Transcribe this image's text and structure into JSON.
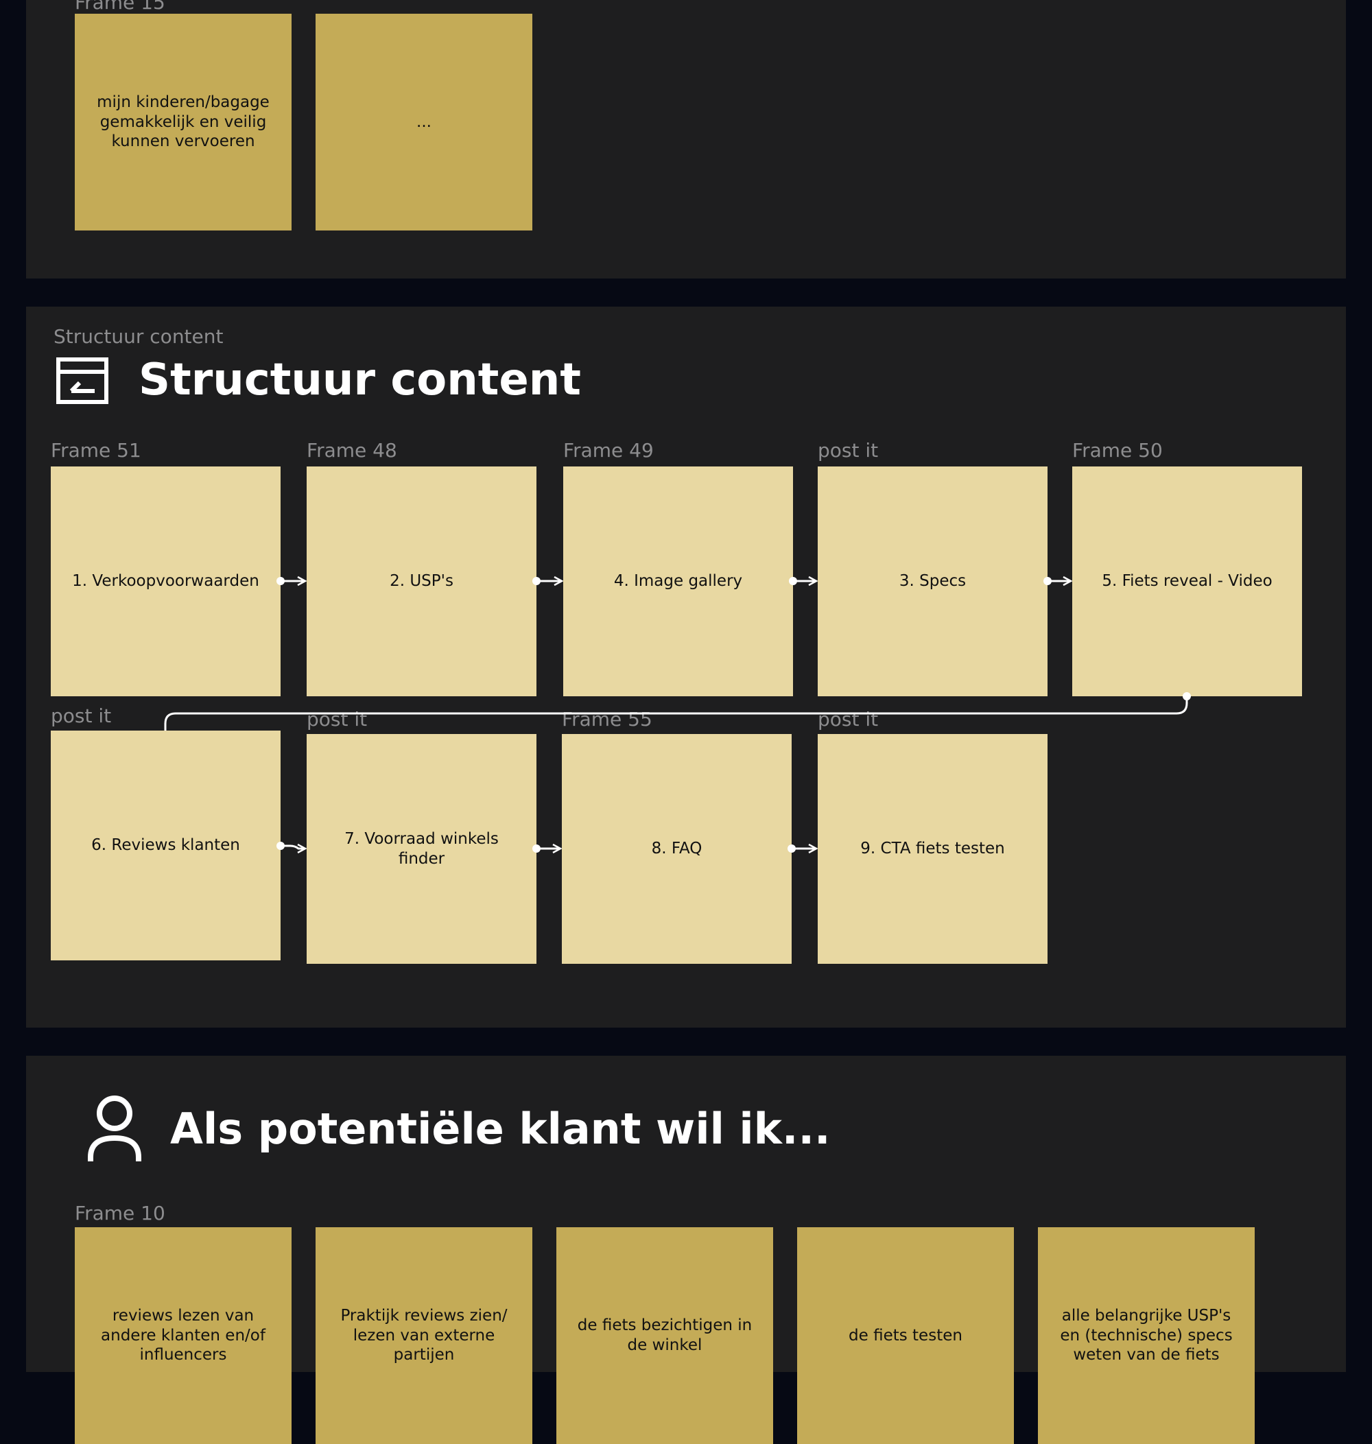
{
  "top_section": {
    "frame_label": "Frame 15",
    "notes": [
      "mijn kinderen/bagage gemakkelijk en veilig kunnen vervoeren",
      "..."
    ]
  },
  "structure_section": {
    "section_label": "Structuur content",
    "title": "Structuur content",
    "icon": "layout-icon",
    "row1": [
      {
        "frame": "Frame 51",
        "text": "1. Verkoopvoorwaarden"
      },
      {
        "frame": "Frame 48",
        "text": "2. USP's"
      },
      {
        "frame": "Frame 49",
        "text": "4. Image gallery"
      },
      {
        "frame": "post it",
        "text": "3. Specs"
      },
      {
        "frame": "Frame 50",
        "text": "5. Fiets reveal - Video"
      }
    ],
    "row2": [
      {
        "frame": "post it",
        "text": "6. Reviews klanten"
      },
      {
        "frame": "post it",
        "text": "7. Voorraad winkels finder"
      },
      {
        "frame": "Frame 55",
        "text": "8. FAQ"
      },
      {
        "frame": "post it",
        "text": "9. CTA fiets testen"
      }
    ]
  },
  "customer_section": {
    "title": "Als potentiële klant wil ik...",
    "icon": "user-icon",
    "frame_label": "Frame 10",
    "notes": [
      "reviews lezen van andere klanten en/of influencers",
      "Praktijk reviews zien/ lezen van externe partijen",
      "de fiets bezichtigen in de winkel",
      "de fiets testen",
      "alle belangrijke USP's en (technische) specs weten van de fiets"
    ]
  },
  "colors": {
    "background": "#060914",
    "section": "#1e1e1f",
    "sticky_gold": "#c4ab57",
    "sticky_light": "#e8d8a2",
    "connector": "#ffffff"
  }
}
